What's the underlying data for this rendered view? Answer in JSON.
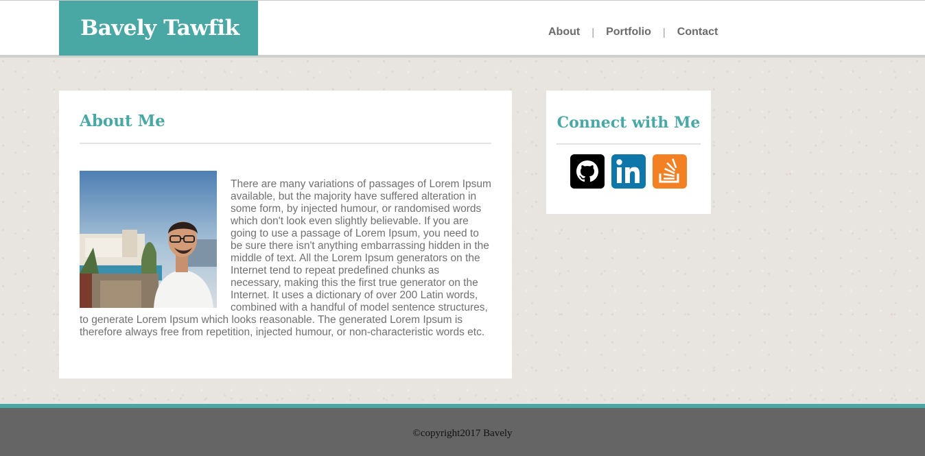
{
  "header": {
    "brand": "Bavely Tawfik",
    "nav": {
      "about": "About",
      "portfolio": "Portfolio",
      "contact": "Contact",
      "separator": "|"
    }
  },
  "about": {
    "title": "About Me",
    "photo_icon": "profile-photo",
    "text": "There are many variations of passages of Lorem Ipsum available, but the majority have suffered alteration in some form, by injected humour, or randomised words which don't look even slightly believable. If you are going to use a passage of Lorem Ipsum, you need to be sure there isn't anything embarrassing hidden in the middle of text. All the Lorem Ipsum generators on the Internet tend to repeat predefined chunks as necessary, making this the first true generator on the Internet. It uses a dictionary of over 200 Latin words, combined with a handful of model sentence structures, to generate Lorem Ipsum which looks reasonable. The generated Lorem Ipsum is therefore always free from repetition, injected humour, or non-characteristic words etc."
  },
  "connect": {
    "title": "Connect with Me",
    "social": [
      {
        "icon": "github-icon",
        "color": "#000000"
      },
      {
        "icon": "linkedin-icon",
        "color": "#0e76a8"
      },
      {
        "icon": "stackoverflow-icon",
        "color": "#f48024"
      }
    ]
  },
  "footer": {
    "copyright": "©copyright2017 Bavely"
  },
  "colors": {
    "accent": "#4aa8a4",
    "footer_bg": "#656565",
    "text_muted": "#707070"
  }
}
